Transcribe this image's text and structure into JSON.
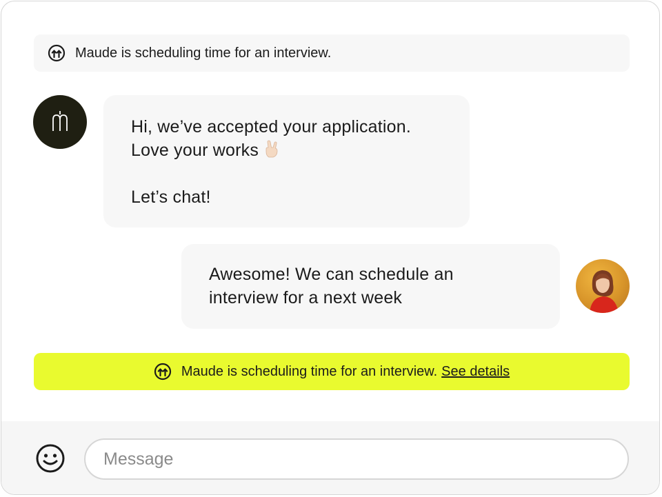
{
  "notices": {
    "top": {
      "text": "Maude is scheduling time for an interview.",
      "icon": "scheduling-icon"
    },
    "bottom": {
      "text": "Maude is scheduling time for an interview.",
      "link": "See details",
      "icon": "scheduling-icon",
      "background": "#e9fa2f"
    }
  },
  "messages": [
    {
      "sender": "company",
      "avatar_icon": "brand-logo-icon",
      "lines": [
        "Hi, we’ve accepted your application.",
        "Love your works",
        "Let’s chat!"
      ],
      "emoji": "rock-on-hand-icon"
    },
    {
      "sender": "user",
      "avatar_icon": "user-photo-avatar",
      "lines": [
        "Awesome! We can schedule an",
        "interview for a next week"
      ]
    }
  ],
  "composer": {
    "placeholder": "Message",
    "emoji_button_icon": "smiley-icon"
  },
  "colors": {
    "accent": "#e9fa2f",
    "bubble": "#f7f7f7",
    "brand_avatar": "#1f1f12"
  }
}
